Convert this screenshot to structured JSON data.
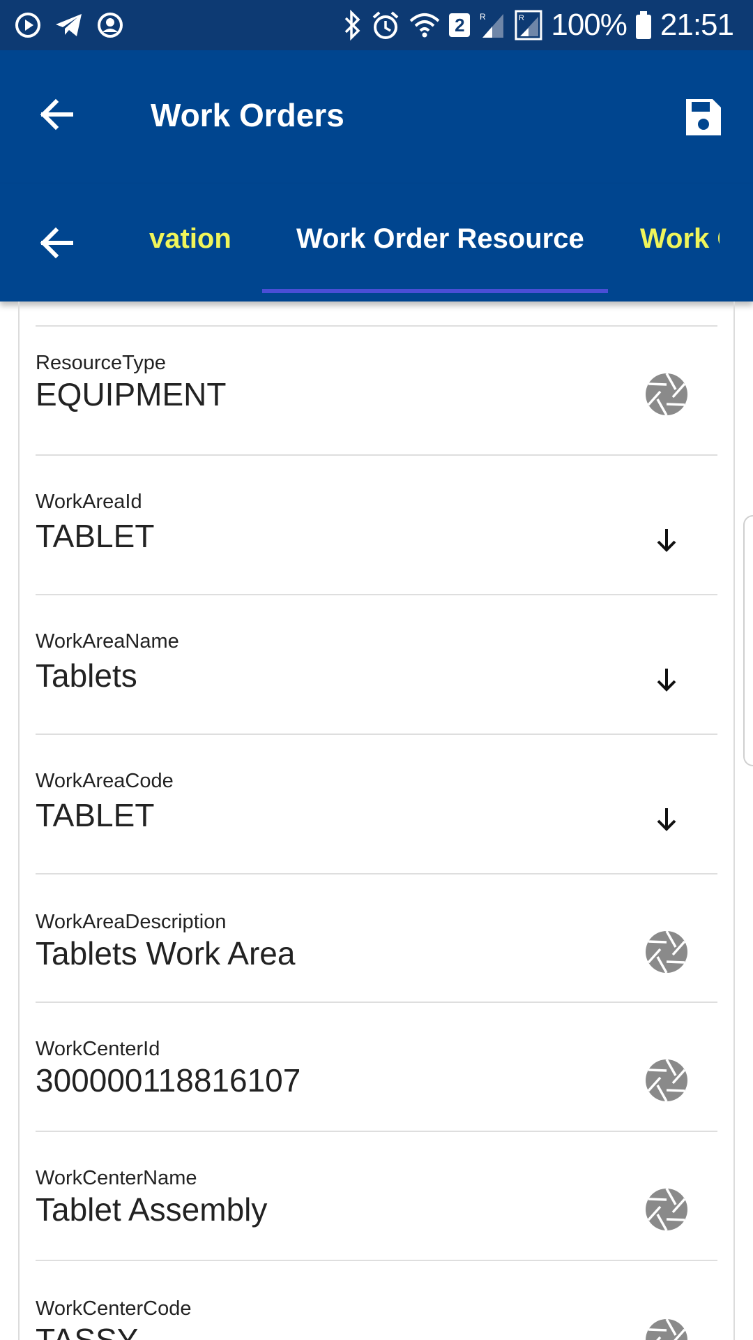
{
  "status_bar": {
    "battery_percent": "100%",
    "time": "21:51",
    "sim_badge": "2",
    "icons": [
      "media-play-icon",
      "telegram-icon",
      "account-circle-icon",
      "bluetooth-icon",
      "alarm-icon",
      "wifi-icon",
      "signal-icon",
      "battery-icon"
    ]
  },
  "app_bar": {
    "title": "Work Orders",
    "icons": [
      "back-arrow-icon",
      "save-icon"
    ]
  },
  "tabs": {
    "items": [
      {
        "label": "vation",
        "active": false
      },
      {
        "label": "Work Order Resource",
        "active": true
      },
      {
        "label": "Work O",
        "active": false
      }
    ],
    "colors": {
      "inactive": "#f0f55a",
      "active": "#ffffff",
      "indicator": "#4a4ed6"
    }
  },
  "fields": [
    {
      "label": "ResourceType",
      "value": "EQUIPMENT",
      "action_icon": "camera-shutter-icon"
    },
    {
      "label": "WorkAreaId",
      "value": "TABLET",
      "action_icon": "arrow-down-icon"
    },
    {
      "label": "WorkAreaName",
      "value": "Tablets",
      "action_icon": "arrow-down-icon"
    },
    {
      "label": "WorkAreaCode",
      "value": "TABLET",
      "action_icon": "arrow-down-icon"
    },
    {
      "label": "WorkAreaDescription",
      "value": "Tablets Work Area",
      "action_icon": "camera-shutter-icon"
    },
    {
      "label": "WorkCenterId",
      "value": "300000118816107",
      "action_icon": "camera-shutter-icon"
    },
    {
      "label": "WorkCenterName",
      "value": "Tablet Assembly",
      "action_icon": "camera-shutter-icon"
    },
    {
      "label": "WorkCenterCode",
      "value": "TASSY",
      "action_icon": "camera-shutter-icon"
    }
  ],
  "colors": {
    "status_bar": "#0d3a73",
    "app_bar": "#00458f",
    "text": "#222222",
    "icon_gray": "#8a8a8a"
  }
}
